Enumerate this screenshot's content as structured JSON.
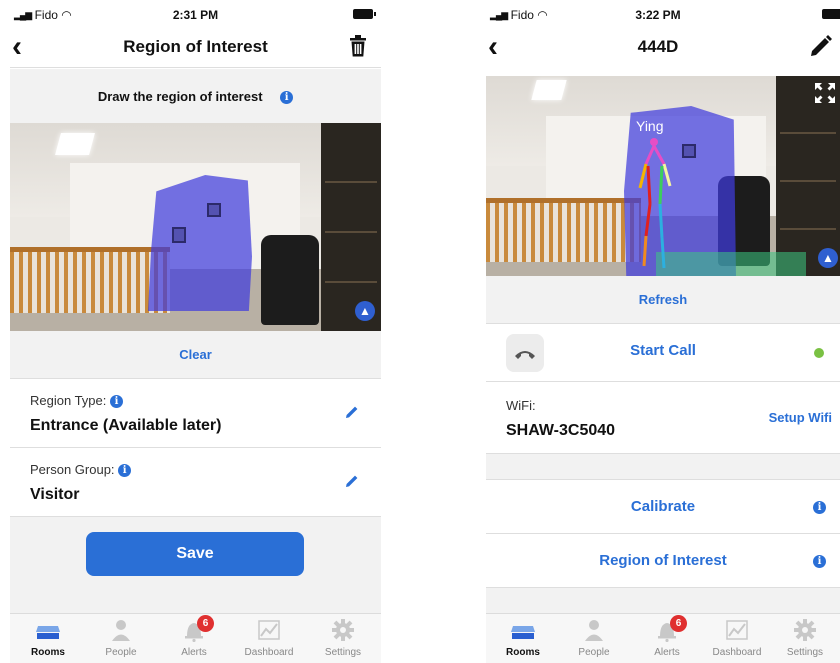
{
  "colors": {
    "accent": "#2a6fd6",
    "region_overlay": "#403cdc",
    "status_online": "#7ac143",
    "badge": "#e03030"
  },
  "left_screen": {
    "status": {
      "carrier": "Fido",
      "time": "2:31 PM"
    },
    "nav": {
      "back_icon": "chevron-left-icon",
      "title": "Region of Interest",
      "action_icon": "trash-icon"
    },
    "instruction": {
      "text": "Draw the region of interest",
      "icon": "info-icon"
    },
    "clear_label": "Clear",
    "region_type": {
      "label": "Region Type:",
      "value": "Entrance (Available later)",
      "edit_icon": "pencil-icon"
    },
    "person_group": {
      "label": "Person Group:",
      "value": "Visitor",
      "edit_icon": "pencil-icon"
    },
    "save_label": "Save"
  },
  "right_screen": {
    "status": {
      "carrier": "Fido",
      "time": "3:22 PM"
    },
    "nav": {
      "back_icon": "chevron-left-icon",
      "title": "444D",
      "action_icon": "pencil-icon"
    },
    "camera": {
      "person_label": "Ying",
      "expand_icon": "expand-icon"
    },
    "refresh_label": "Refresh",
    "call": {
      "label": "Start Call",
      "icon": "phone-icon",
      "status": "online"
    },
    "wifi": {
      "label": "WiFi:",
      "network": "SHAW-3C5040",
      "setup_label": "Setup Wifi"
    },
    "calibrate_label": "Calibrate",
    "roi_label": "Region of Interest"
  },
  "tab_bar": {
    "items": [
      {
        "label": "Rooms",
        "icon": "rooms-icon",
        "active": true
      },
      {
        "label": "People",
        "icon": "people-icon",
        "active": false
      },
      {
        "label": "Alerts",
        "icon": "bell-icon",
        "active": false,
        "badge": "6"
      },
      {
        "label": "Dashboard",
        "icon": "chart-icon",
        "active": false
      },
      {
        "label": "Settings",
        "icon": "gear-icon",
        "active": false
      }
    ]
  }
}
